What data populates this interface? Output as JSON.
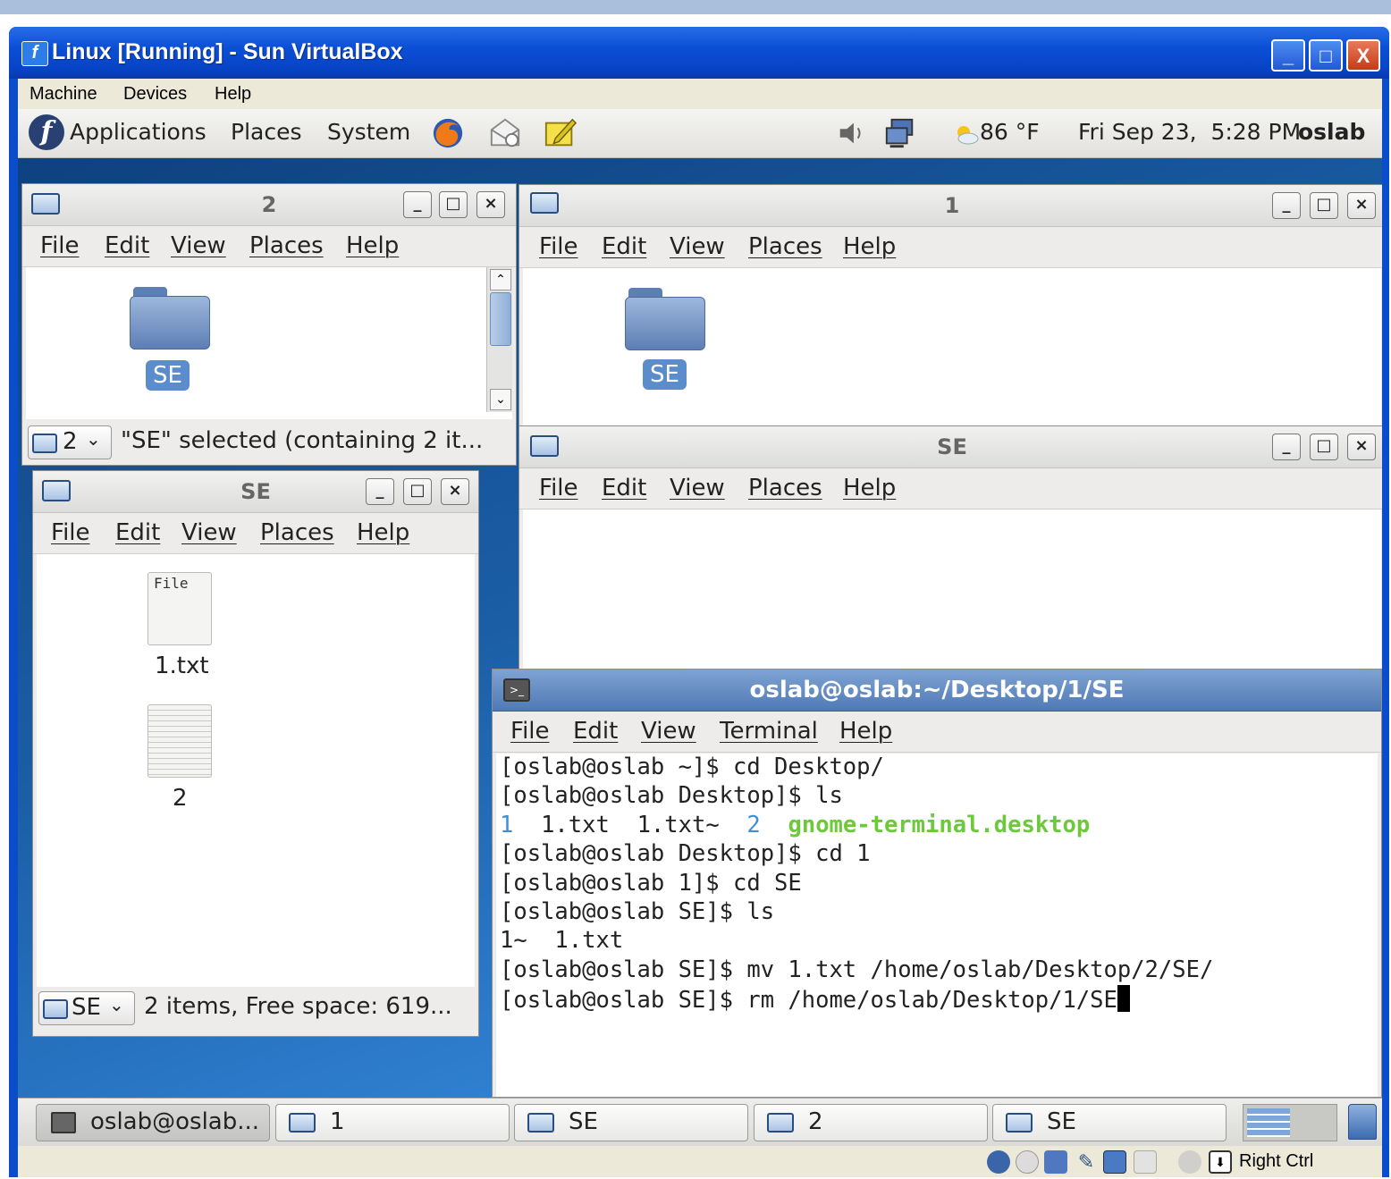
{
  "vbox": {
    "title": "Linux [Running] - Sun VirtualBox",
    "menu": [
      "Machine",
      "Devices",
      "Help"
    ],
    "host_key": "Right Ctrl",
    "buttons": {
      "minimize": "_",
      "maximize": "□",
      "close": "X"
    }
  },
  "panel": {
    "menus": [
      "Applications",
      "Places",
      "System"
    ],
    "weather": "86 °F",
    "clock": "Fri Sep 23,  5:28 PM",
    "user": "oslab"
  },
  "menu_labels": [
    "File",
    "Edit",
    "View",
    "Places",
    "Help"
  ],
  "win_2": {
    "title": "2",
    "folder": "SE",
    "location": "2",
    "status": "\"SE\" selected (containing 2 it..."
  },
  "win_1": {
    "title": "1",
    "folder": "SE"
  },
  "win_se_right": {
    "title": "SE"
  },
  "win_se_left": {
    "title": "SE",
    "items": [
      {
        "name": "1.txt",
        "thumb_text": "File"
      },
      {
        "name": "2"
      }
    ],
    "location": "SE",
    "status": "2 items, Free space: 619..."
  },
  "terminal": {
    "title": "oslab@oslab:~/Desktop/1/SE",
    "menu": [
      "File",
      "Edit",
      "View",
      "Terminal",
      "Help"
    ],
    "lines": [
      "[oslab@oslab ~]$ cd Desktop/",
      "[oslab@oslab Desktop]$ ls",
      "",
      "[oslab@oslab Desktop]$ cd 1",
      "[oslab@oslab 1]$ cd SE",
      "[oslab@oslab SE]$ ls",
      "1~  1.txt",
      "[oslab@oslab SE]$ mv 1.txt /home/oslab/Desktop/2/SE/",
      "[oslab@oslab SE]$ rm /home/oslab/Desktop/1/SE"
    ],
    "ls_output": {
      "dir1": "1",
      "f1": "1.txt",
      "f2": "1.txt~",
      "dir2": "2",
      "exec": "gnome-terminal.desktop"
    },
    "colors": {
      "dir": "#3f8fd8",
      "exec": "#6cc93a"
    }
  },
  "taskbar": [
    "oslab@oslab...",
    "1",
    "SE",
    "2",
    "SE"
  ]
}
